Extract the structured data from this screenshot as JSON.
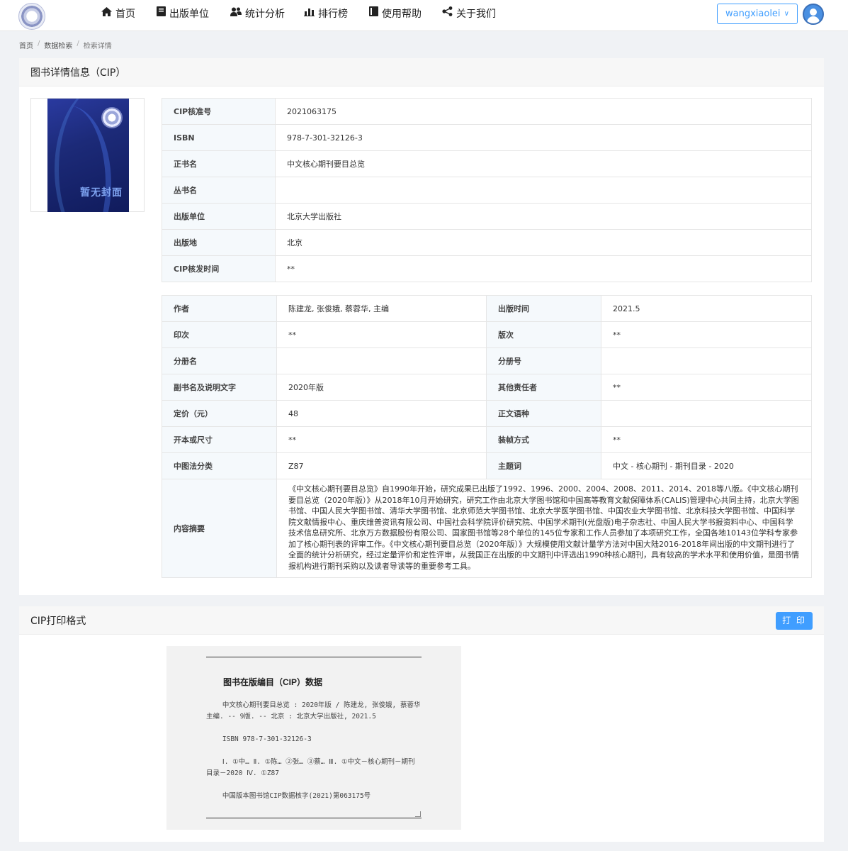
{
  "nav": {
    "items": [
      {
        "label": "首页",
        "icon": "home-icon"
      },
      {
        "label": "出版单位",
        "icon": "book-icon"
      },
      {
        "label": "统计分析",
        "icon": "users-icon"
      },
      {
        "label": "排行榜",
        "icon": "bar-chart-icon"
      },
      {
        "label": "使用帮助",
        "icon": "help-book-icon"
      },
      {
        "label": "关于我们",
        "icon": "share-icon"
      }
    ],
    "user": "wangxiaolei"
  },
  "breadcrumb": [
    "首页",
    "数据检索",
    "检索详情"
  ],
  "detail": {
    "title": "图书详情信息（CIP）",
    "cover_text": "暂无封面",
    "basic": [
      {
        "label": "CIP核准号",
        "value": "2021063175"
      },
      {
        "label": "ISBN",
        "value": "978-7-301-32126-3"
      },
      {
        "label": "正书名",
        "value": "中文核心期刊要目总览"
      },
      {
        "label": "丛书名",
        "value": ""
      },
      {
        "label": "出版单位",
        "value": "北京大学出版社"
      },
      {
        "label": "出版地",
        "value": "北京"
      },
      {
        "label": "CIP核发时间",
        "value": "**"
      }
    ],
    "extra": [
      {
        "l1": "作者",
        "v1": "陈建龙, 张俊娥, 蔡蓉华, 主编",
        "l2": "出版时间",
        "v2": "2021.5"
      },
      {
        "l1": "印次",
        "v1": "**",
        "l2": "版次",
        "v2": "**"
      },
      {
        "l1": "分册名",
        "v1": "",
        "l2": "分册号",
        "v2": ""
      },
      {
        "l1": "副书名及说明文字",
        "v1": "2020年版",
        "l2": "其他责任者",
        "v2": "**"
      },
      {
        "l1": "定价（元）",
        "v1": "48",
        "l2": "正文语种",
        "v2": ""
      },
      {
        "l1": "开本或尺寸",
        "v1": "**",
        "l2": "装帧方式",
        "v2": "**"
      },
      {
        "l1": "中图法分类",
        "v1": "Z87",
        "l2": "主题词",
        "v2": "中文 - 核心期刊 - 期刊目录 - 2020"
      }
    ],
    "abstract_label": "内容摘要",
    "abstract": "《中文核心期刊要目总览》自1990年开始，研究成果已出版了1992、1996、2000、2004、2008、2011、2014、2018等八版。《中文核心期刊要目总览（2020年版）》从2018年10月开始研究，研究工作由北京大学图书馆和中国高等教育文献保障体系(CALIS)管理中心共同主持，北京大学图书馆、中国人民大学图书馆、清华大学图书馆、北京师范大学图书馆、北京大学医学图书馆、中国农业大学图书馆、北京科技大学图书馆、中国科学院文献情报中心、重庆维普资讯有限公司、中国社会科学院评价研究院、中国学术期刊(光盘版)电子杂志社、中国人民大学书报资料中心、中国科学技术信息研究所、北京万方数据股份有限公司、国家图书馆等28个单位的145位专家和工作人员参加了本项研究工作，全国各地10143位学科专家参加了核心期刊表的评审工作。《中文核心期刊要目总览（2020年版）》大规模使用文献计量学方法对中国大陆2016-2018年间出版的中文期刊进行了全面的统计分析研究，经过定量评价和定性评审，从我国正在出版的中文期刊中评选出1990种核心期刊，具有较高的学术水平和使用价值，是图书情报机构进行期刊采购以及读者导读等的重要参考工具。"
  },
  "cip_print": {
    "title": "CIP打印格式",
    "print_button": "打 印",
    "block_title": "图书在版编目（CIP）数据",
    "line1": "    中文核心期刊要目总览 : 2020年版 / 陈建龙, 张俊娥, 蔡蓉华主编. -- 9版. -- 北京 : 北京大学出版社, 2021.5",
    "line2": "    ISBN 978-7-301-32126-3",
    "line3": "    Ⅰ. ①中… Ⅱ. ①陈… ②张… ③蔡… Ⅲ. ①中文－核心期刊－期刊目录－2020 Ⅳ. ①Z87",
    "line4": "    中国版本图书馆CIP数据核字(2021)第063175号"
  }
}
